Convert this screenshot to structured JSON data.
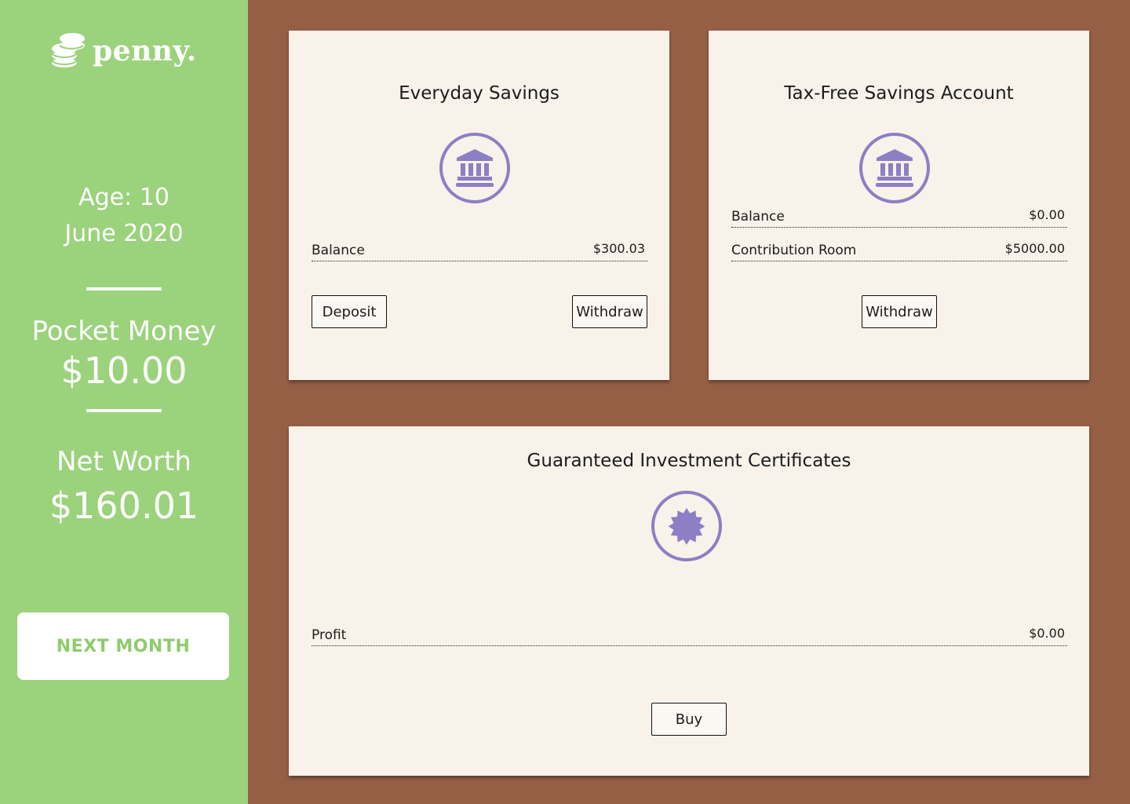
{
  "app": {
    "name": "penny."
  },
  "sidebar": {
    "age": "Age: 10",
    "date": "June 2020",
    "pocket_money_label": "Pocket Money",
    "pocket_money_value": "$10.00",
    "net_worth_label": "Net Worth",
    "net_worth_value": "$160.01",
    "next_month_label": "NEXT MONTH"
  },
  "accounts": {
    "everyday": {
      "title": "Everyday Savings",
      "icon": "bank-icon",
      "balance_label": "Balance",
      "balance_value": "$300.03",
      "deposit_label": "Deposit",
      "withdraw_label": "Withdraw"
    },
    "tfsa": {
      "title": "Tax-Free Savings Account",
      "icon": "bank-icon",
      "balance_label": "Balance",
      "balance_value": "$0.00",
      "room_label": "Contribution Room",
      "room_value": "$5000.00",
      "withdraw_label": "Withdraw"
    },
    "gic": {
      "title": "Guaranteed Investment Certificates",
      "icon": "certificate-seal-icon",
      "profit_label": "Profit",
      "profit_value": "$0.00",
      "buy_label": "Buy"
    }
  },
  "colors": {
    "sidebar_bg": "#9bd27c",
    "main_bg": "#955f45",
    "card_bg": "#f8f2ea",
    "icon_accent": "#8c7fc4",
    "button_text": "#8fcb6c"
  }
}
